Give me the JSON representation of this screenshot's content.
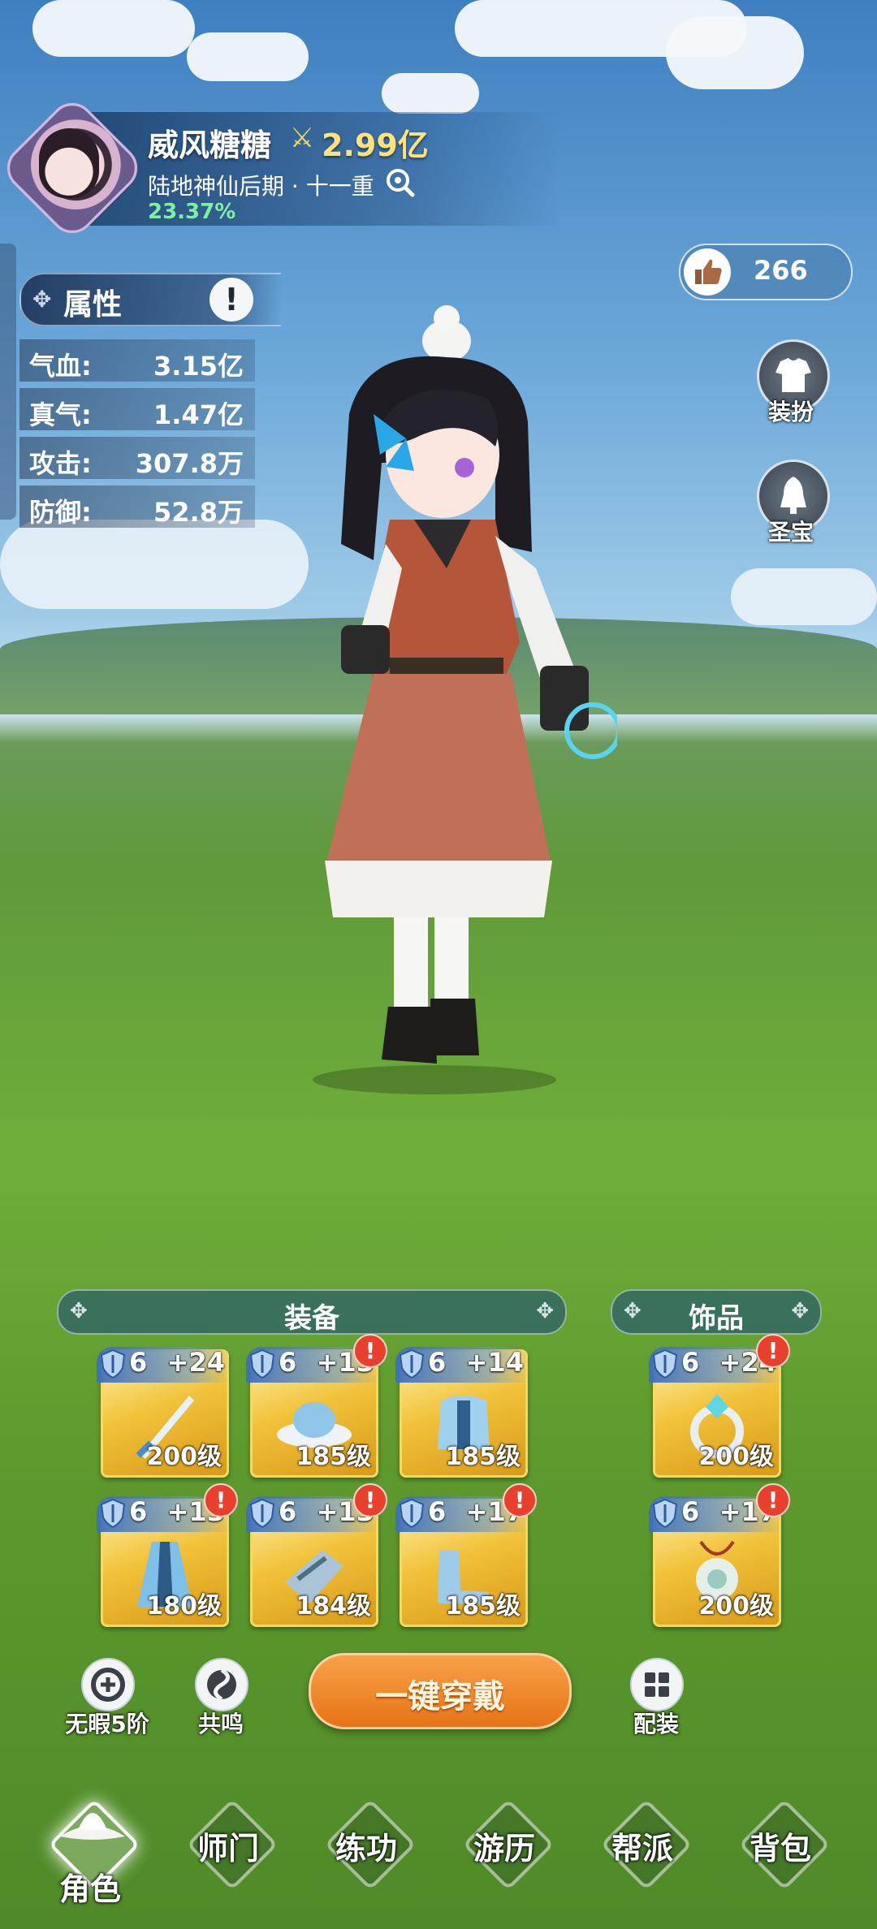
{
  "player": {
    "name": "威风糖糖",
    "power": "2.99亿",
    "realm": "陆地神仙后期 · 十一重",
    "progress": "23.37%"
  },
  "likes": {
    "count": "266"
  },
  "side_buttons": [
    {
      "label": "装扮",
      "icon": "outfit-icon"
    },
    {
      "label": "圣宝",
      "icon": "bell-icon"
    }
  ],
  "attributes": {
    "title": "属性",
    "info_icon": "!",
    "rows": [
      {
        "label": "气血:",
        "value": "3.15亿"
      },
      {
        "label": "真气:",
        "value": "1.47亿"
      },
      {
        "label": "攻击:",
        "value": "307.8万"
      },
      {
        "label": "防御:",
        "value": "52.8万"
      }
    ]
  },
  "equipment": {
    "title": "装备",
    "slots": [
      {
        "tier": "6",
        "plus": "+24",
        "level": "200级",
        "alert": false,
        "item": "sword"
      },
      {
        "tier": "6",
        "plus": "+13",
        "level": "185级",
        "alert": true,
        "item": "hat"
      },
      {
        "tier": "6",
        "plus": "+14",
        "level": "185级",
        "alert": false,
        "item": "armor"
      },
      {
        "tier": "6",
        "plus": "+13",
        "level": "180级",
        "alert": true,
        "item": "robe"
      },
      {
        "tier": "6",
        "plus": "+13",
        "level": "184级",
        "alert": true,
        "item": "gauntlet"
      },
      {
        "tier": "6",
        "plus": "+17",
        "level": "185级",
        "alert": true,
        "item": "boots"
      }
    ]
  },
  "accessories": {
    "title": "饰品",
    "slots": [
      {
        "tier": "6",
        "plus": "+24",
        "level": "200级",
        "alert": true,
        "item": "ring"
      },
      {
        "tier": "6",
        "plus": "+17",
        "level": "200级",
        "alert": true,
        "item": "pendant"
      }
    ]
  },
  "actions": {
    "flawless": "无暇5阶",
    "resonance": "共鸣",
    "equip_all": "一键穿戴",
    "loadout": "配装"
  },
  "nav": [
    {
      "label": "角色",
      "active": true
    },
    {
      "label": "师门",
      "active": false
    },
    {
      "label": "练功",
      "active": false
    },
    {
      "label": "游历",
      "active": false
    },
    {
      "label": "帮派",
      "active": false
    },
    {
      "label": "背包",
      "active": false
    }
  ],
  "colors": {
    "accent": "#e77316",
    "gold": "#f2c23a",
    "progress": "#7ef0a6",
    "alert": "#e8402c"
  }
}
